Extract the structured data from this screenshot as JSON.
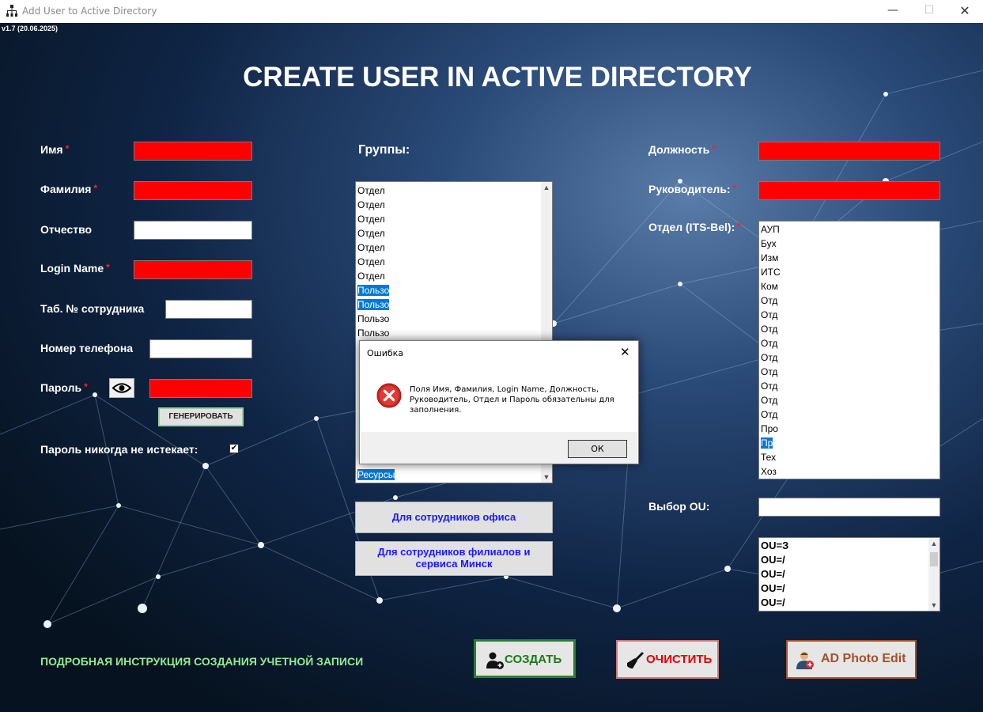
{
  "window": {
    "title": "Add User to Active Directory",
    "minimize_glyph": "—",
    "maximize_glyph": "☐",
    "close_glyph": "✕"
  },
  "version": "v1.7 (20.06.2025)",
  "page_title": "CREATE USER IN ACTIVE DIRECTORY",
  "required_marker": "*",
  "left_form": {
    "first_name_label": "Имя",
    "last_name_label": "Фамилия",
    "middle_name_label": "Отчество",
    "login_label": "Login Name",
    "employee_id_label": "Таб. № сотрудника",
    "phone_label": "Номер телефона",
    "password_label": "Пароль",
    "generate_button": "ГЕНЕРИРОВАТЬ",
    "never_expires_label": "Пароль никогда не истекает:",
    "never_expires_checked": true,
    "check_glyph": "✔"
  },
  "groups": {
    "label": "Группы:",
    "items": [
      {
        "text": "Отдел",
        "selected": false
      },
      {
        "text": "Отдел",
        "selected": false
      },
      {
        "text": "Отдел",
        "selected": false
      },
      {
        "text": "Отдел",
        "selected": false
      },
      {
        "text": "Отдел",
        "selected": false
      },
      {
        "text": "Отдел",
        "selected": false
      },
      {
        "text": "Отдел",
        "selected": false
      },
      {
        "text": "Пользо",
        "selected": true
      },
      {
        "text": "Пользо",
        "selected": true
      },
      {
        "text": "Пользо",
        "selected": false
      },
      {
        "text": "Пользо",
        "selected": false
      }
    ],
    "last_item": "Ресурсы",
    "office_button": "Для сотрудников офиса",
    "branch_button": "Для сотрудников филиалов и сервиса Минск"
  },
  "right_form": {
    "position_label": "Должность",
    "manager_label": "Руководитель:",
    "department_label": "Отдел (ITS-Bel):",
    "departments": [
      {
        "text": "АУП",
        "selected": false
      },
      {
        "text": "Бух",
        "selected": false
      },
      {
        "text": "Изм",
        "selected": false
      },
      {
        "text": "ИТС",
        "selected": false
      },
      {
        "text": "Ком",
        "selected": false
      },
      {
        "text": "Отд",
        "selected": false
      },
      {
        "text": "Отд",
        "selected": false
      },
      {
        "text": "Отд",
        "selected": false
      },
      {
        "text": "Отд",
        "selected": false
      },
      {
        "text": "Отд",
        "selected": false
      },
      {
        "text": "Отд",
        "selected": false
      },
      {
        "text": "Отд",
        "selected": false
      },
      {
        "text": "Отд",
        "selected": false
      },
      {
        "text": "Отд",
        "selected": false
      },
      {
        "text": "Про",
        "selected": false
      },
      {
        "text": "Пр",
        "selected": true
      },
      {
        "text": "Тех",
        "selected": false
      },
      {
        "text": "Хоз",
        "selected": false
      }
    ],
    "ou_label": "Выбор OU:",
    "ou_items": [
      "OU=З",
      "OU=/",
      "OU=/",
      "OU=/",
      "OU=/"
    ]
  },
  "bottom": {
    "instructions_link": "ПОДРОБНАЯ ИНСТРУКЦИЯ СОЗДАНИЯ УЧЕТНОЙ ЗАПИСИ",
    "create_button": "СОЗДАТЬ",
    "clear_button": "ОЧИСТИТЬ",
    "photo_button": "AD Photo Edit"
  },
  "dialog": {
    "title": "Ошибка",
    "message": "Поля Имя, Фамилия, Login Name, Должность, Руководитель, Отдел и Пароль обязательны для заполнения.",
    "ok_button": "ОК",
    "close_glyph": "✕"
  },
  "icons": {
    "app": "network-tree-icon",
    "eye": "eye-icon",
    "error": "error-circle-icon",
    "create": "add-user-icon",
    "clear": "broom-icon",
    "photo": "user-photo-icon"
  },
  "colors": {
    "required_field": "#ff0000",
    "create_border": "#2e7d32",
    "create_text": "#1b7a1b",
    "clear_border": "#c77a7a",
    "clear_text": "#e00000",
    "photo_border": "#a0522d",
    "photo_text": "#a0522d",
    "link_text": "#90ee90",
    "selection": "#0078d7"
  }
}
